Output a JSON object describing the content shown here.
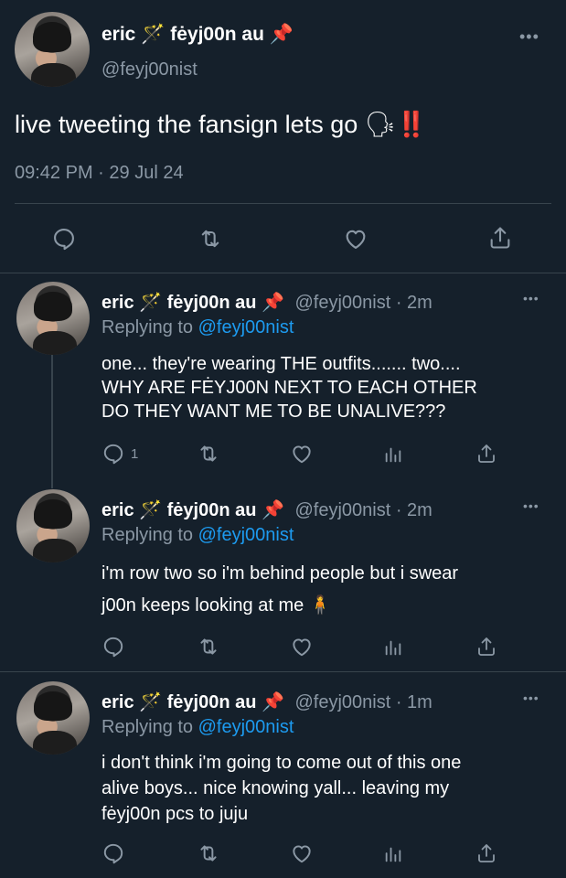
{
  "main_tweet": {
    "author_name": "eric",
    "author_suffix": "fėyj00n au",
    "handle": "@feyj00nist",
    "text": "live tweeting the fansign lets go",
    "emoji": "🗣‼️",
    "time": "09:42 PM",
    "date_sep": "·",
    "date": "29 Jul 24",
    "more_label": "•••"
  },
  "replies": [
    {
      "author_name": "eric",
      "author_suffix": "fėyj00n au",
      "handle": "@feyj00nist",
      "age": "· 2m",
      "replying_prefix": "Replying to",
      "replying_handle": "@feyj00nist",
      "text_lines": [
        "one... they're wearing THE outfits....... two....",
        "WHY ARE FĖYJ00N NEXT TO EACH OTHER",
        "DO THEY WANT ME TO BE UNALIVE???"
      ],
      "reply_count": "1",
      "more_label": "•••"
    },
    {
      "author_name": "eric",
      "author_suffix": "fėyj00n au",
      "handle": "@feyj00nist",
      "age": "· 2m",
      "replying_prefix": "Replying to",
      "replying_handle": "@feyj00nist",
      "text_lines": [
        "i'm row two so i'm behind people but i swear",
        "j00n keeps looking at me 🧍"
      ],
      "reply_count": "",
      "more_label": "•••"
    },
    {
      "author_name": "eric",
      "author_suffix": "fėyj00n au",
      "handle": "@feyj00nist",
      "age": "· 1m",
      "replying_prefix": "Replying to",
      "replying_handle": "@feyj00nist",
      "text_lines": [
        "i don't think i'm going to come out of this one",
        "alive boys... nice knowing yall... leaving my",
        "fėyj00n pcs to juju"
      ],
      "reply_count": "",
      "more_label": "•••"
    }
  ],
  "colors": {
    "background": "#15202b",
    "muted": "#8b98a5",
    "link": "#1d9bf0",
    "divider": "#38444d"
  },
  "icons": {
    "wand": "magic-wand-icon",
    "pin": "pushpin-icon",
    "reply": "reply-icon",
    "retweet": "retweet-icon",
    "like": "heart-icon",
    "views": "analytics-icon",
    "share": "share-icon"
  }
}
